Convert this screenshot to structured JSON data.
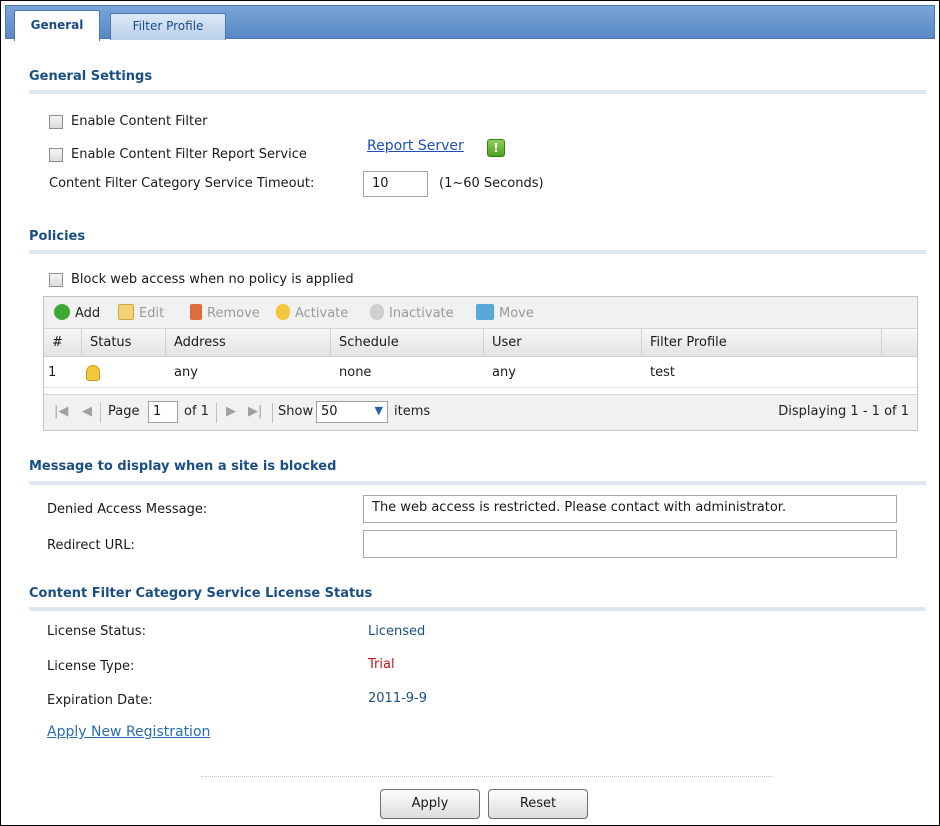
{
  "tabs": [
    {
      "label": "General",
      "active": true
    },
    {
      "label": "Filter Profile",
      "active": false
    }
  ],
  "general_settings": {
    "title": "General Settings",
    "enable_content_filter": "Enable Content Filter",
    "enable_report_service": "Enable Content Filter Report Service",
    "report_server_link": "Report Server",
    "timeout_label": "Content Filter Category Service Timeout:",
    "timeout_value": "10",
    "timeout_hint": "(1~60 Seconds)"
  },
  "policies": {
    "title": "Policies",
    "block_label": "Block web access when no policy is applied",
    "toolbar": {
      "add": "Add",
      "edit": "Edit",
      "remove": "Remove",
      "activate": "Activate",
      "inactivate": "Inactivate",
      "move": "Move"
    },
    "columns": [
      "#",
      "Status",
      "Address",
      "Schedule",
      "User",
      "Filter Profile"
    ],
    "rows": [
      {
        "num": "1",
        "status": "lightbulb-on",
        "address": "any",
        "schedule": "none",
        "user": "any",
        "filter_profile": "test"
      }
    ],
    "pager": {
      "page_label": "Page",
      "page_value": "1",
      "of_label": "of 1",
      "show_label": "Show",
      "show_value": "50",
      "items_label": "items",
      "displaying": "Displaying 1 - 1 of 1"
    }
  },
  "message": {
    "title": "Message to display when a site is blocked",
    "denied_label": "Denied Access Message:",
    "denied_value": "The web access is restricted. Please contact with administrator.",
    "redirect_label": "Redirect URL:",
    "redirect_value": ""
  },
  "license": {
    "title": "Content Filter Category Service License Status",
    "status_label": "License Status:",
    "status_value": "Licensed",
    "type_label": "License Type:",
    "type_value": "Trial",
    "expiration_label": "Expiration Date:",
    "expiration_value": "2011-9-9",
    "apply_link": "Apply New Registration"
  },
  "buttons": {
    "apply": "Apply",
    "reset": "Reset"
  },
  "colors": {
    "section_title": "#1a4f85",
    "link": "#1f4fb8",
    "licensed": "#1a4f85",
    "trial": "#c0161c"
  }
}
